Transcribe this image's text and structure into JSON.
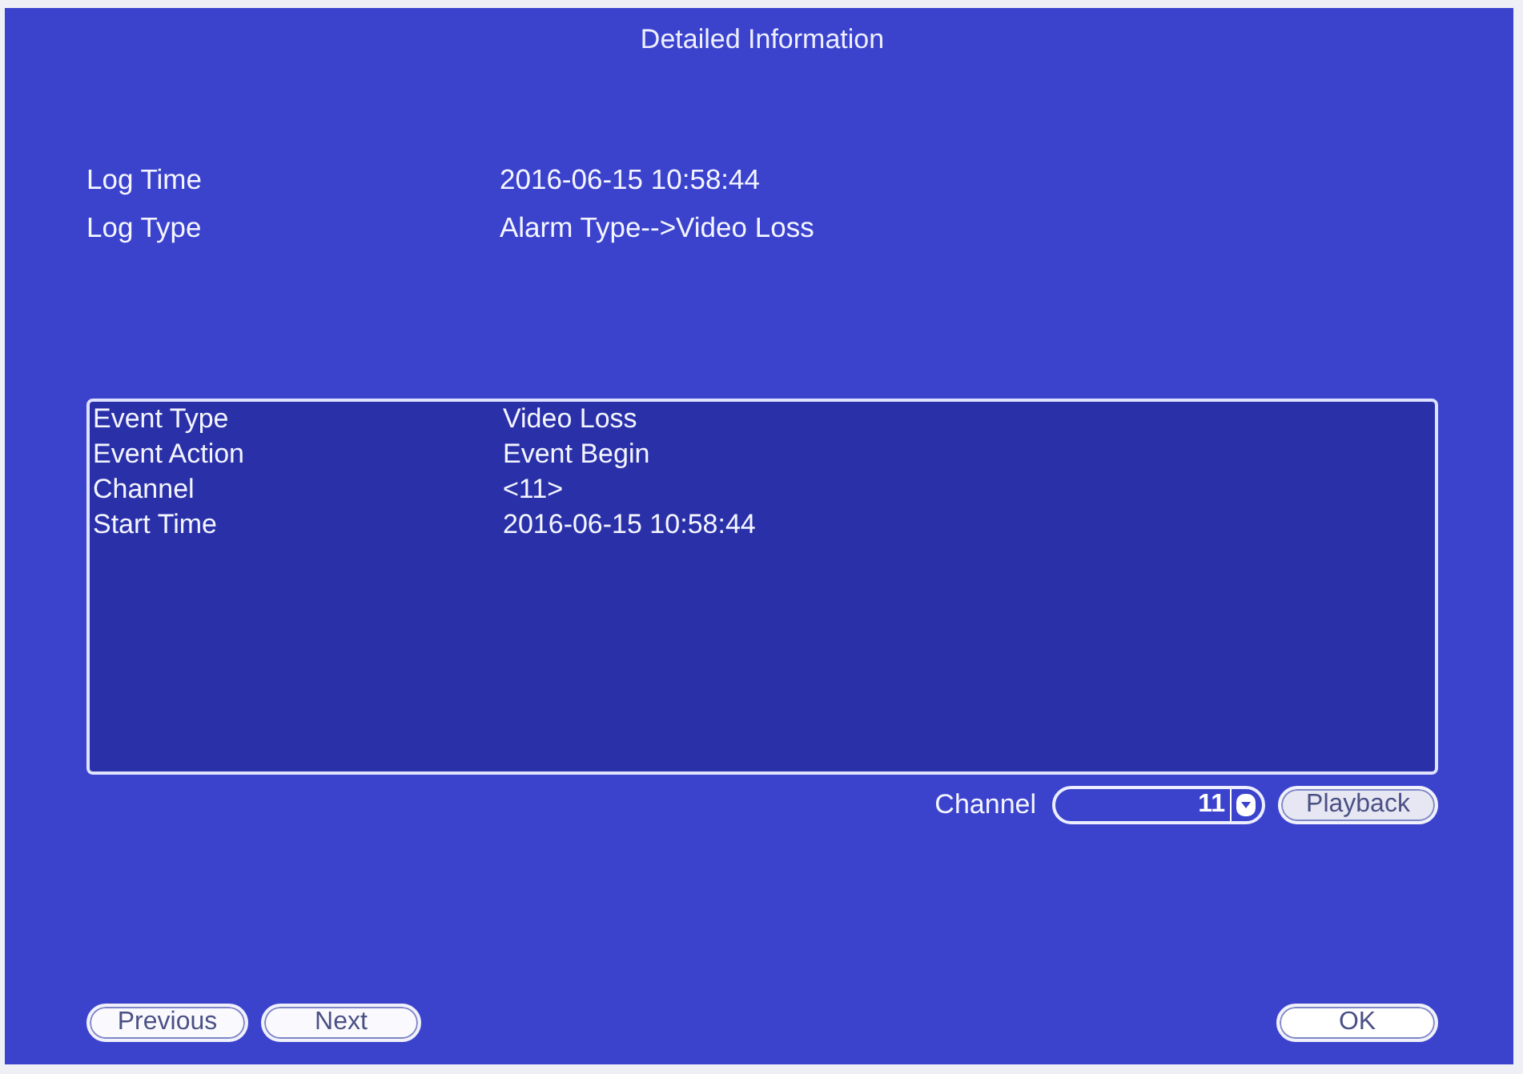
{
  "window": {
    "title": "Detailed Information"
  },
  "log_info": [
    {
      "label": "Log Time",
      "value": "2016-06-15 10:58:44"
    },
    {
      "label": "Log Type",
      "value": "Alarm Type-->Video Loss"
    }
  ],
  "event_details": [
    {
      "label": "Event Type",
      "value": "Video Loss"
    },
    {
      "label": "Event Action",
      "value": "Event Begin"
    },
    {
      "label": "Channel",
      "value": "<11>"
    },
    {
      "label": "Start Time",
      "value": "2016-06-15 10:58:44"
    }
  ],
  "channel_select": {
    "label": "Channel",
    "value": "11"
  },
  "playback_button": "Playback",
  "nav_buttons": [
    "Previous",
    "Next"
  ],
  "ok_button": "OK"
}
